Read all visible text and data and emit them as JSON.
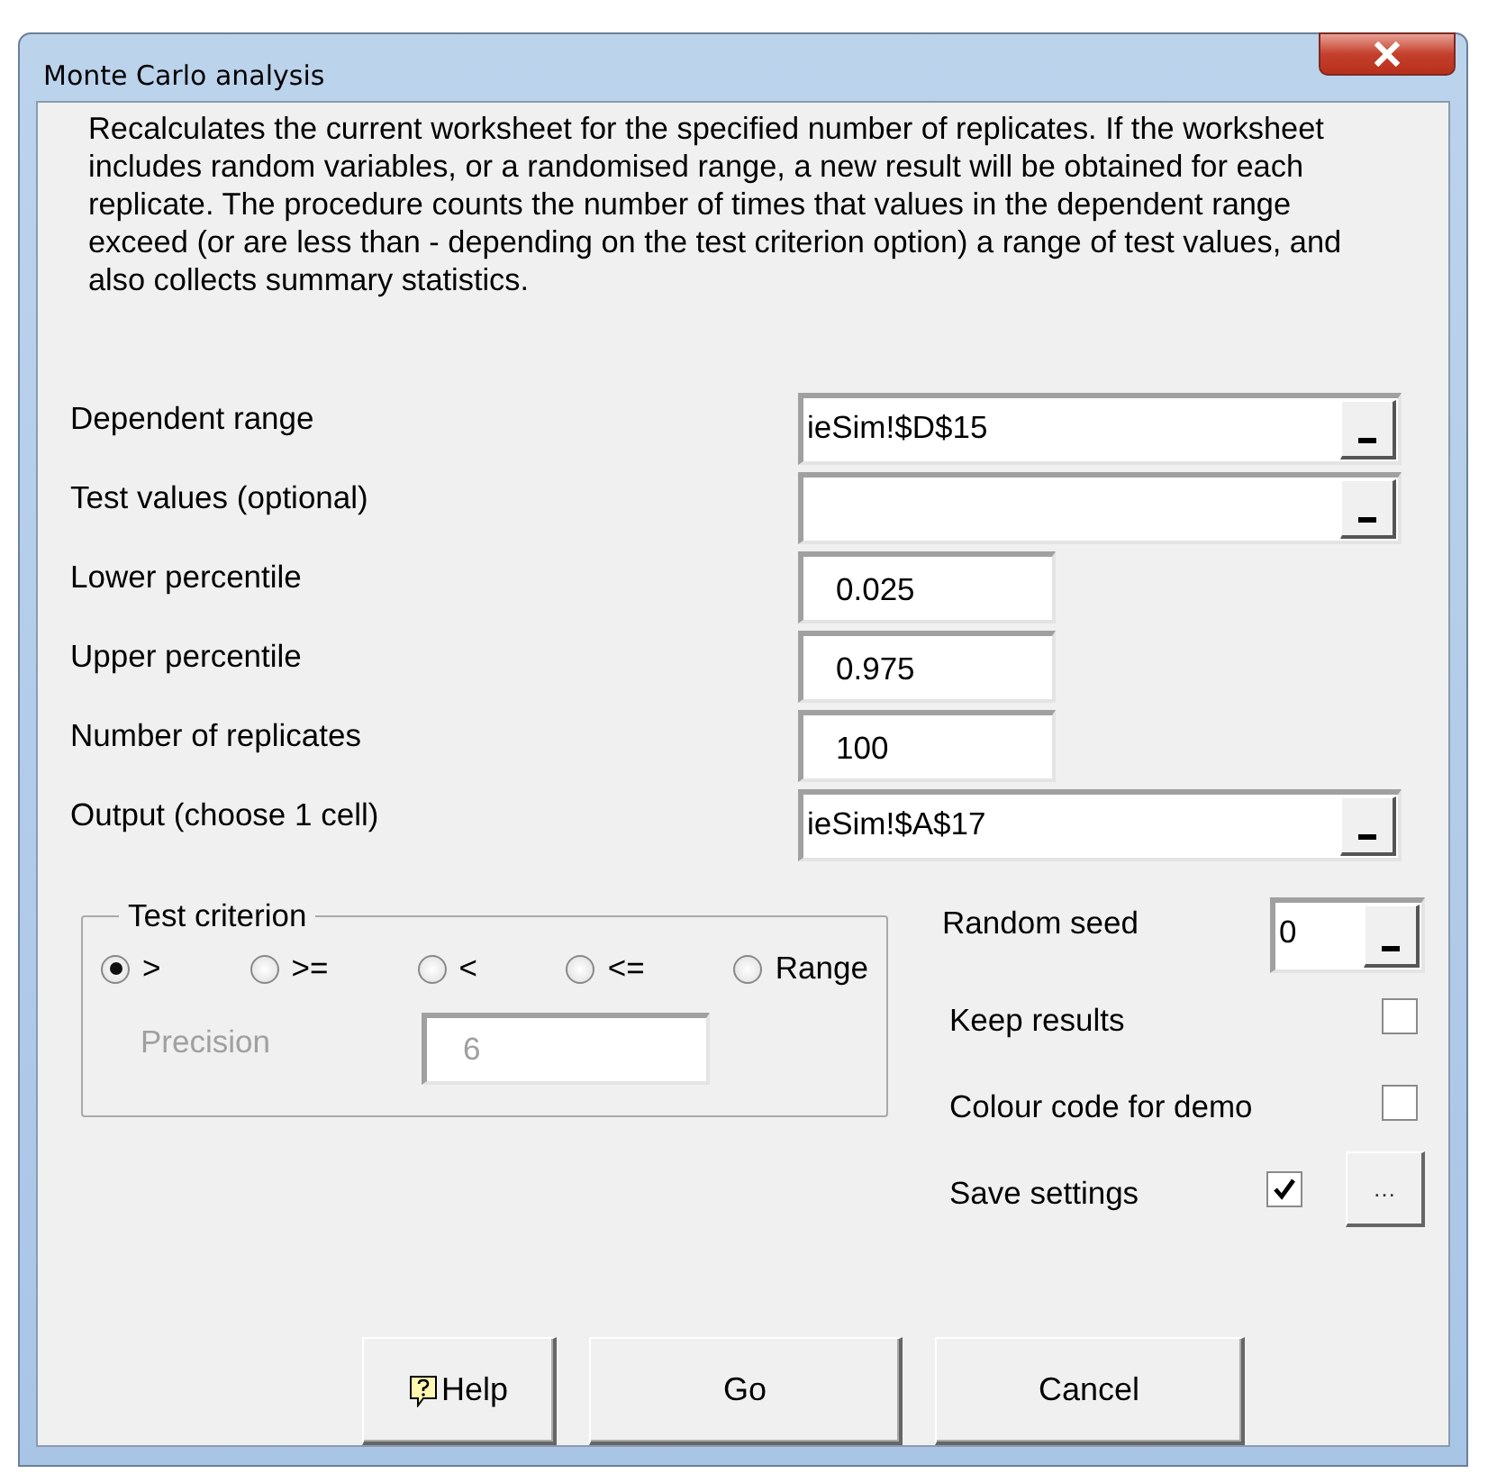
{
  "window": {
    "title": "Monte Carlo analysis"
  },
  "description": "Recalculates the current worksheet for the specified number of replicates. If the worksheet includes random variables, or a randomised range, a new result will be obtained for each replicate. The procedure counts the number of times that values in the dependent range exceed (or are less than - depending on the test criterion option) a range of test values, and also collects summary statistics.",
  "fields": [
    {
      "label": "Dependent range",
      "value": "ieSim!$D$15",
      "kind": "range"
    },
    {
      "label": "Test values (optional)",
      "kind": "range"
    },
    {
      "label": "Lower percentile",
      "value": "0.025",
      "kind": "number"
    },
    {
      "label": "Upper percentile",
      "value": "0.975",
      "kind": "number"
    },
    {
      "label": "Number of replicates",
      "value": "100",
      "kind": "number"
    },
    {
      "label": "Output (choose 1 cell)",
      "value": "ieSim!$A$17",
      "kind": "range"
    }
  ],
  "test_criterion": {
    "title": "Test criterion",
    "options": [
      {
        "label": ">",
        "selected": true
      },
      {
        "label": ">=",
        "selected": false
      },
      {
        "label": "<",
        "selected": false
      },
      {
        "label": "<=",
        "selected": false
      },
      {
        "label": "Range",
        "selected": false
      }
    ],
    "precision": {
      "label": "Precision",
      "value": "6",
      "disabled": true
    }
  },
  "random_seed": {
    "label": "Random seed",
    "value": "0"
  },
  "options": [
    {
      "label": "Keep results",
      "checked": false
    },
    {
      "label": "Colour code for demo",
      "checked": false
    },
    {
      "label": "Save settings",
      "checked": true
    }
  ],
  "more_button": "…",
  "buttons": [
    {
      "label": "Help",
      "kind": "help"
    },
    {
      "label": "Go",
      "kind": "plain"
    },
    {
      "label": "Cancel",
      "kind": "plain"
    }
  ]
}
